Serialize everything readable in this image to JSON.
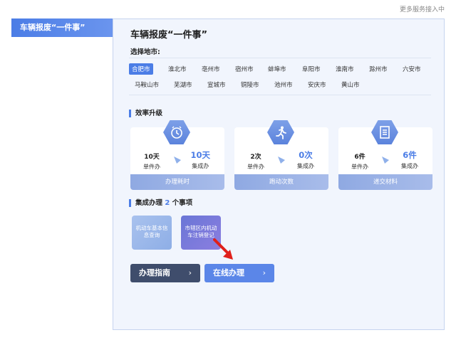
{
  "top_note": "更多服务接入中",
  "sidebar": {
    "active_tab": "车辆报废“一件事”"
  },
  "panel": {
    "title": "车辆报废“一件事”",
    "city_label": "选择地市:",
    "cities": [
      "合肥市",
      "淮北市",
      "亳州市",
      "宿州市",
      "蚌埠市",
      "阜阳市",
      "淮南市",
      "滁州市",
      "六安市",
      "马鞍山市",
      "芜湖市",
      "宣城市",
      "铜陵市",
      "池州市",
      "安庆市",
      "黄山市"
    ],
    "selected_city": "合肥市",
    "efficiency": {
      "heading": "效率升级",
      "cards": [
        {
          "icon": "clock-icon",
          "left_value": "10天",
          "left_label": "单件办",
          "right_value": "10天",
          "right_label": "集成办",
          "footer": "办理耗时"
        },
        {
          "icon": "running-person-icon",
          "left_value": "2次",
          "left_label": "单件办",
          "right_value": "0次",
          "right_label": "集成办",
          "footer": "跑动次数"
        },
        {
          "icon": "document-icon",
          "left_value": "6件",
          "left_label": "单件办",
          "right_value": "6件",
          "right_label": "集成办",
          "footer": "递交材料"
        }
      ]
    },
    "integrated": {
      "heading_prefix": "集成办理",
      "count": "2",
      "heading_suffix": "个事项",
      "items": [
        "机动车基本信息查询",
        "市辖区内机动车注销登记"
      ]
    },
    "buttons": {
      "guide": "办理指南",
      "online": "在线办理",
      "chevron": "›"
    }
  },
  "colors": {
    "accent": "#4b7de6",
    "guide_button": "#3f4d6c",
    "pointer": "#e0201b"
  }
}
